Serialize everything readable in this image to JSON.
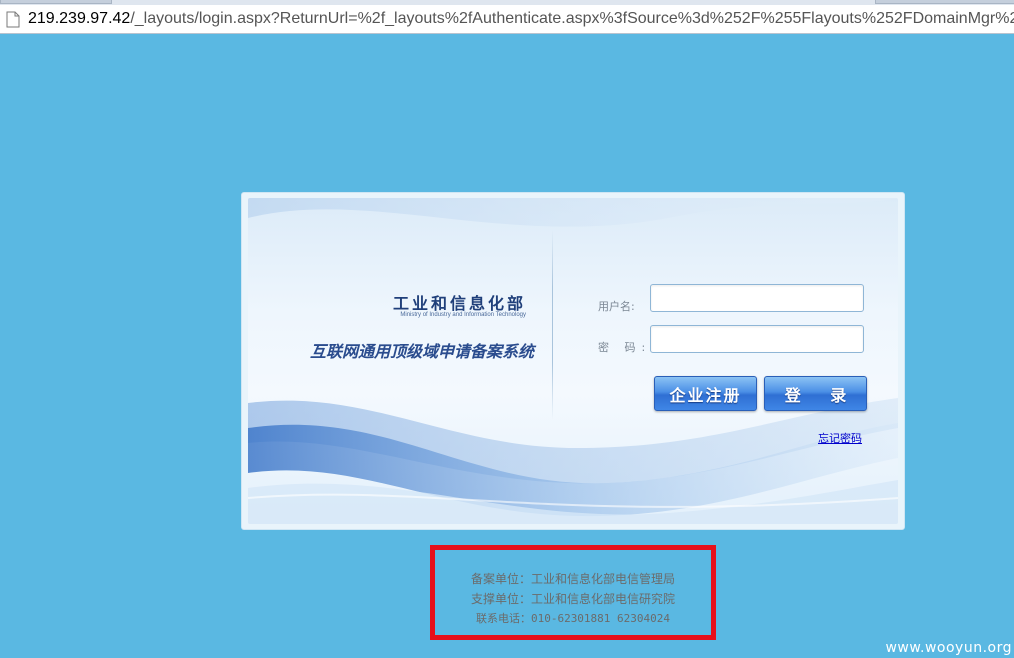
{
  "browser": {
    "url_host": "219.239.97.42",
    "url_path": "/_layouts/login.aspx?ReturnUrl=%2f_layouts%2fAuthenticate.aspx%3fSource%3d%252F%255Flayouts%252FDomainMgr%2"
  },
  "login": {
    "ministry_cn": "工业和信息化部",
    "ministry_en": "Ministry of Industry and Information Technology",
    "system_name": "互联网通用顶级域申请备案系统",
    "username_label": "用户名:",
    "password_label": "密 码:",
    "username_value": "",
    "password_value": "",
    "register_button": "企业注册",
    "login_button": "登 录",
    "forgot_link": "忘记密码"
  },
  "footer": {
    "line1": "备案单位：工业和信息化部电信管理局",
    "line2": "支撑单位：工业和信息化部电信研究院",
    "line3": "联系电话：010-62301881 62304024"
  },
  "watermark": "www.wooyun.org",
  "colors": {
    "background": "#5ab8e2",
    "highlight_border": "#e8101a",
    "button_blue": "#2f6fd3"
  }
}
